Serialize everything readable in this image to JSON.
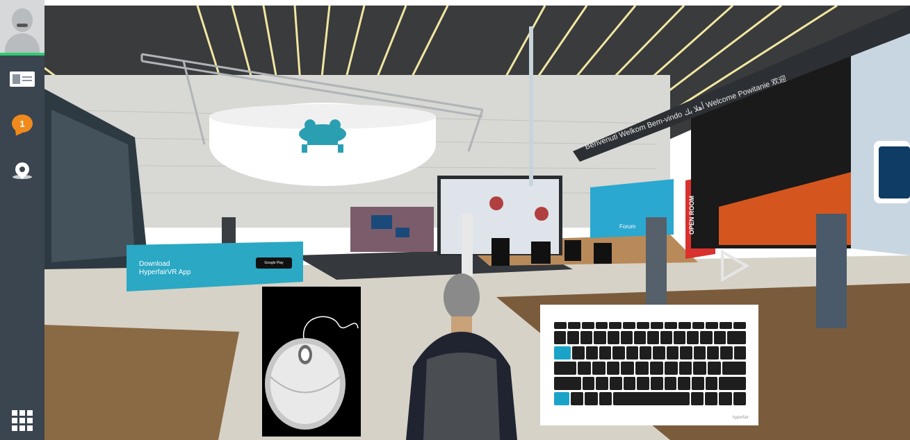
{
  "sidebar": {
    "avatar_label": "User avatar",
    "items": [
      {
        "name": "business-card",
        "icon": "business-card-icon"
      },
      {
        "name": "notifications",
        "icon": "chat-bubble-icon",
        "badge": "1"
      },
      {
        "name": "location",
        "icon": "map-pin-icon"
      },
      {
        "name": "apps-menu",
        "icon": "grid-menu-icon"
      }
    ]
  },
  "scene": {
    "download_banner": {
      "line1": "Download",
      "line2": "HyperfairVR App",
      "store_badge": "Google Play"
    },
    "forum_sign": "Forum",
    "open_room_sign": "OPEN ROOM",
    "welcome_banner": "Benvenuti  Welkom  Bem-vindo  أهلا بك  Welcome  Powitanie  欢迎"
  },
  "overlays": {
    "mouse_help": "mouse-control-guide",
    "keyboard_help": "keyboard-control-guide",
    "keyboard_logo": "hyperfair"
  },
  "colors": {
    "sidebar": "#3b4550",
    "accent_teal": "#1aa3c8",
    "notification": "#f08a1c",
    "online_status": "#2ecc71",
    "open_room": "#d8312e"
  }
}
